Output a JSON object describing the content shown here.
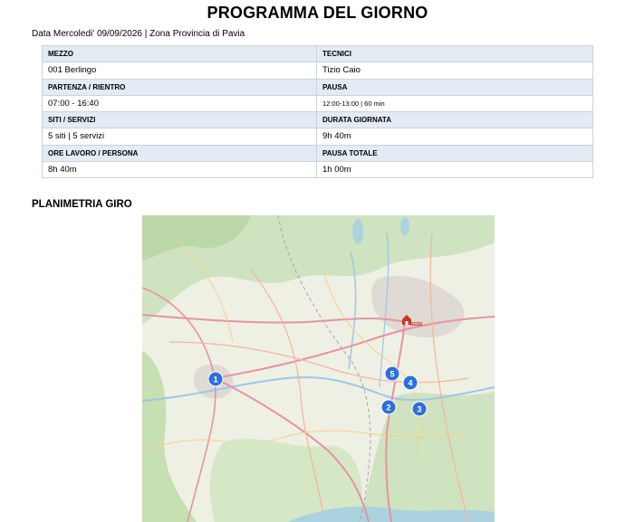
{
  "header": {
    "title": "PROGRAMMA DEL GIORNO",
    "subtitle": "Data Mercoledi' 09/09/2026 | Zona Provincia di Pavia"
  },
  "info_table": {
    "rows": [
      {
        "left_label": "MEZZO",
        "left_value": "001 Berlingo",
        "right_label": "TECNICI",
        "right_value": "Tizio Caio"
      },
      {
        "left_label": "PARTENZA / RIENTRO",
        "left_value": "07:00 - 16:40",
        "right_label": "PAUSA",
        "right_value": "12:00-13:00 | 60 min"
      },
      {
        "left_label": "SITI / SERVIZI",
        "left_value": "5 siti | 5 servizi",
        "right_label": "DURATA GIORNATA",
        "right_value": "9h 40m"
      },
      {
        "left_label": "ORE LAVORO / PERSONA",
        "left_value": "8h 40m",
        "right_label": "PAUSA TOTALE",
        "right_value": "1h 00m"
      }
    ]
  },
  "map_section": {
    "title": "PLANIMETRIA GIRO",
    "depot_label": "SEDE",
    "markers": [
      "1",
      "2",
      "3",
      "4",
      "5"
    ],
    "colors": {
      "marker": "#2f6fdc",
      "depot": "#c0392b"
    }
  }
}
